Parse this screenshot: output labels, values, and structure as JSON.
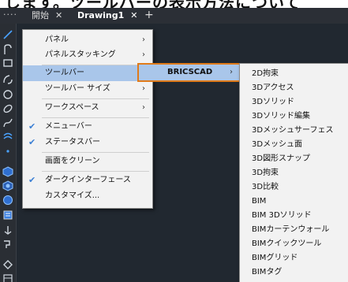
{
  "caption": {
    "text": "します。ツールバーの表示方法について"
  },
  "tabs": {
    "more": "····",
    "home": "開始",
    "home_close": "✕",
    "drawing": "Drawing1",
    "drawing_close": "✕",
    "add": "+"
  },
  "menu1": {
    "items": [
      {
        "label": "パネル",
        "arrow": "›"
      },
      {
        "label": "パネルスタッキング",
        "arrow": "›"
      },
      {
        "label": "ツールバー",
        "arrow": "›"
      },
      {
        "label": "ツールバー サイズ",
        "arrow": "›"
      },
      {
        "label": "ワークスペース",
        "arrow": "›"
      },
      {
        "label": "メニューバー",
        "check": "✔"
      },
      {
        "label": "ステータスバー",
        "check": "✔"
      },
      {
        "label": "画面をクリーン"
      },
      {
        "label": "ダークインターフェース",
        "check": "✔"
      },
      {
        "label": "カスタマイズ..."
      }
    ]
  },
  "menu2": {
    "items": [
      {
        "label": "BRICSCAD",
        "arrow": "›"
      }
    ]
  },
  "menu3": {
    "items": [
      {
        "label": "2D拘束"
      },
      {
        "label": "3Dアクセス"
      },
      {
        "label": "3Dソリッド"
      },
      {
        "label": "3Dソリッド編集"
      },
      {
        "label": "3Dメッシュサーフェス"
      },
      {
        "label": "3Dメッシュ面"
      },
      {
        "label": "3D図形スナップ"
      },
      {
        "label": "3D拘束"
      },
      {
        "label": "3D比較"
      },
      {
        "label": "BIM"
      },
      {
        "label": "BIM 3Dソリッド"
      },
      {
        "label": "BIMカーテンウォール"
      },
      {
        "label": "BIMクイックツール"
      },
      {
        "label": "BIMグリッド"
      },
      {
        "label": "BIMタグ"
      }
    ]
  },
  "toolbar": {
    "icons": [
      "line-icon",
      "polyline-icon",
      "rectangle-icon",
      "arc-icon",
      "circle-icon",
      "ellipse-icon",
      "spline-icon",
      "hatch-icon",
      "point-icon",
      "solid-box-icon",
      "solid-cylinder-icon",
      "solid-sphere-icon",
      "extrude-icon",
      "revolve-icon",
      "loft-icon",
      "sweep-icon",
      "settings-icon"
    ]
  },
  "colors": {
    "app_background": "#212830",
    "menu_background": "#f2f2f2",
    "menu_highlight": "#a9c6ea",
    "submenu_border": "#e07b1a",
    "check": "#3b7fd4",
    "icon_blue": "#4aa3ff"
  }
}
